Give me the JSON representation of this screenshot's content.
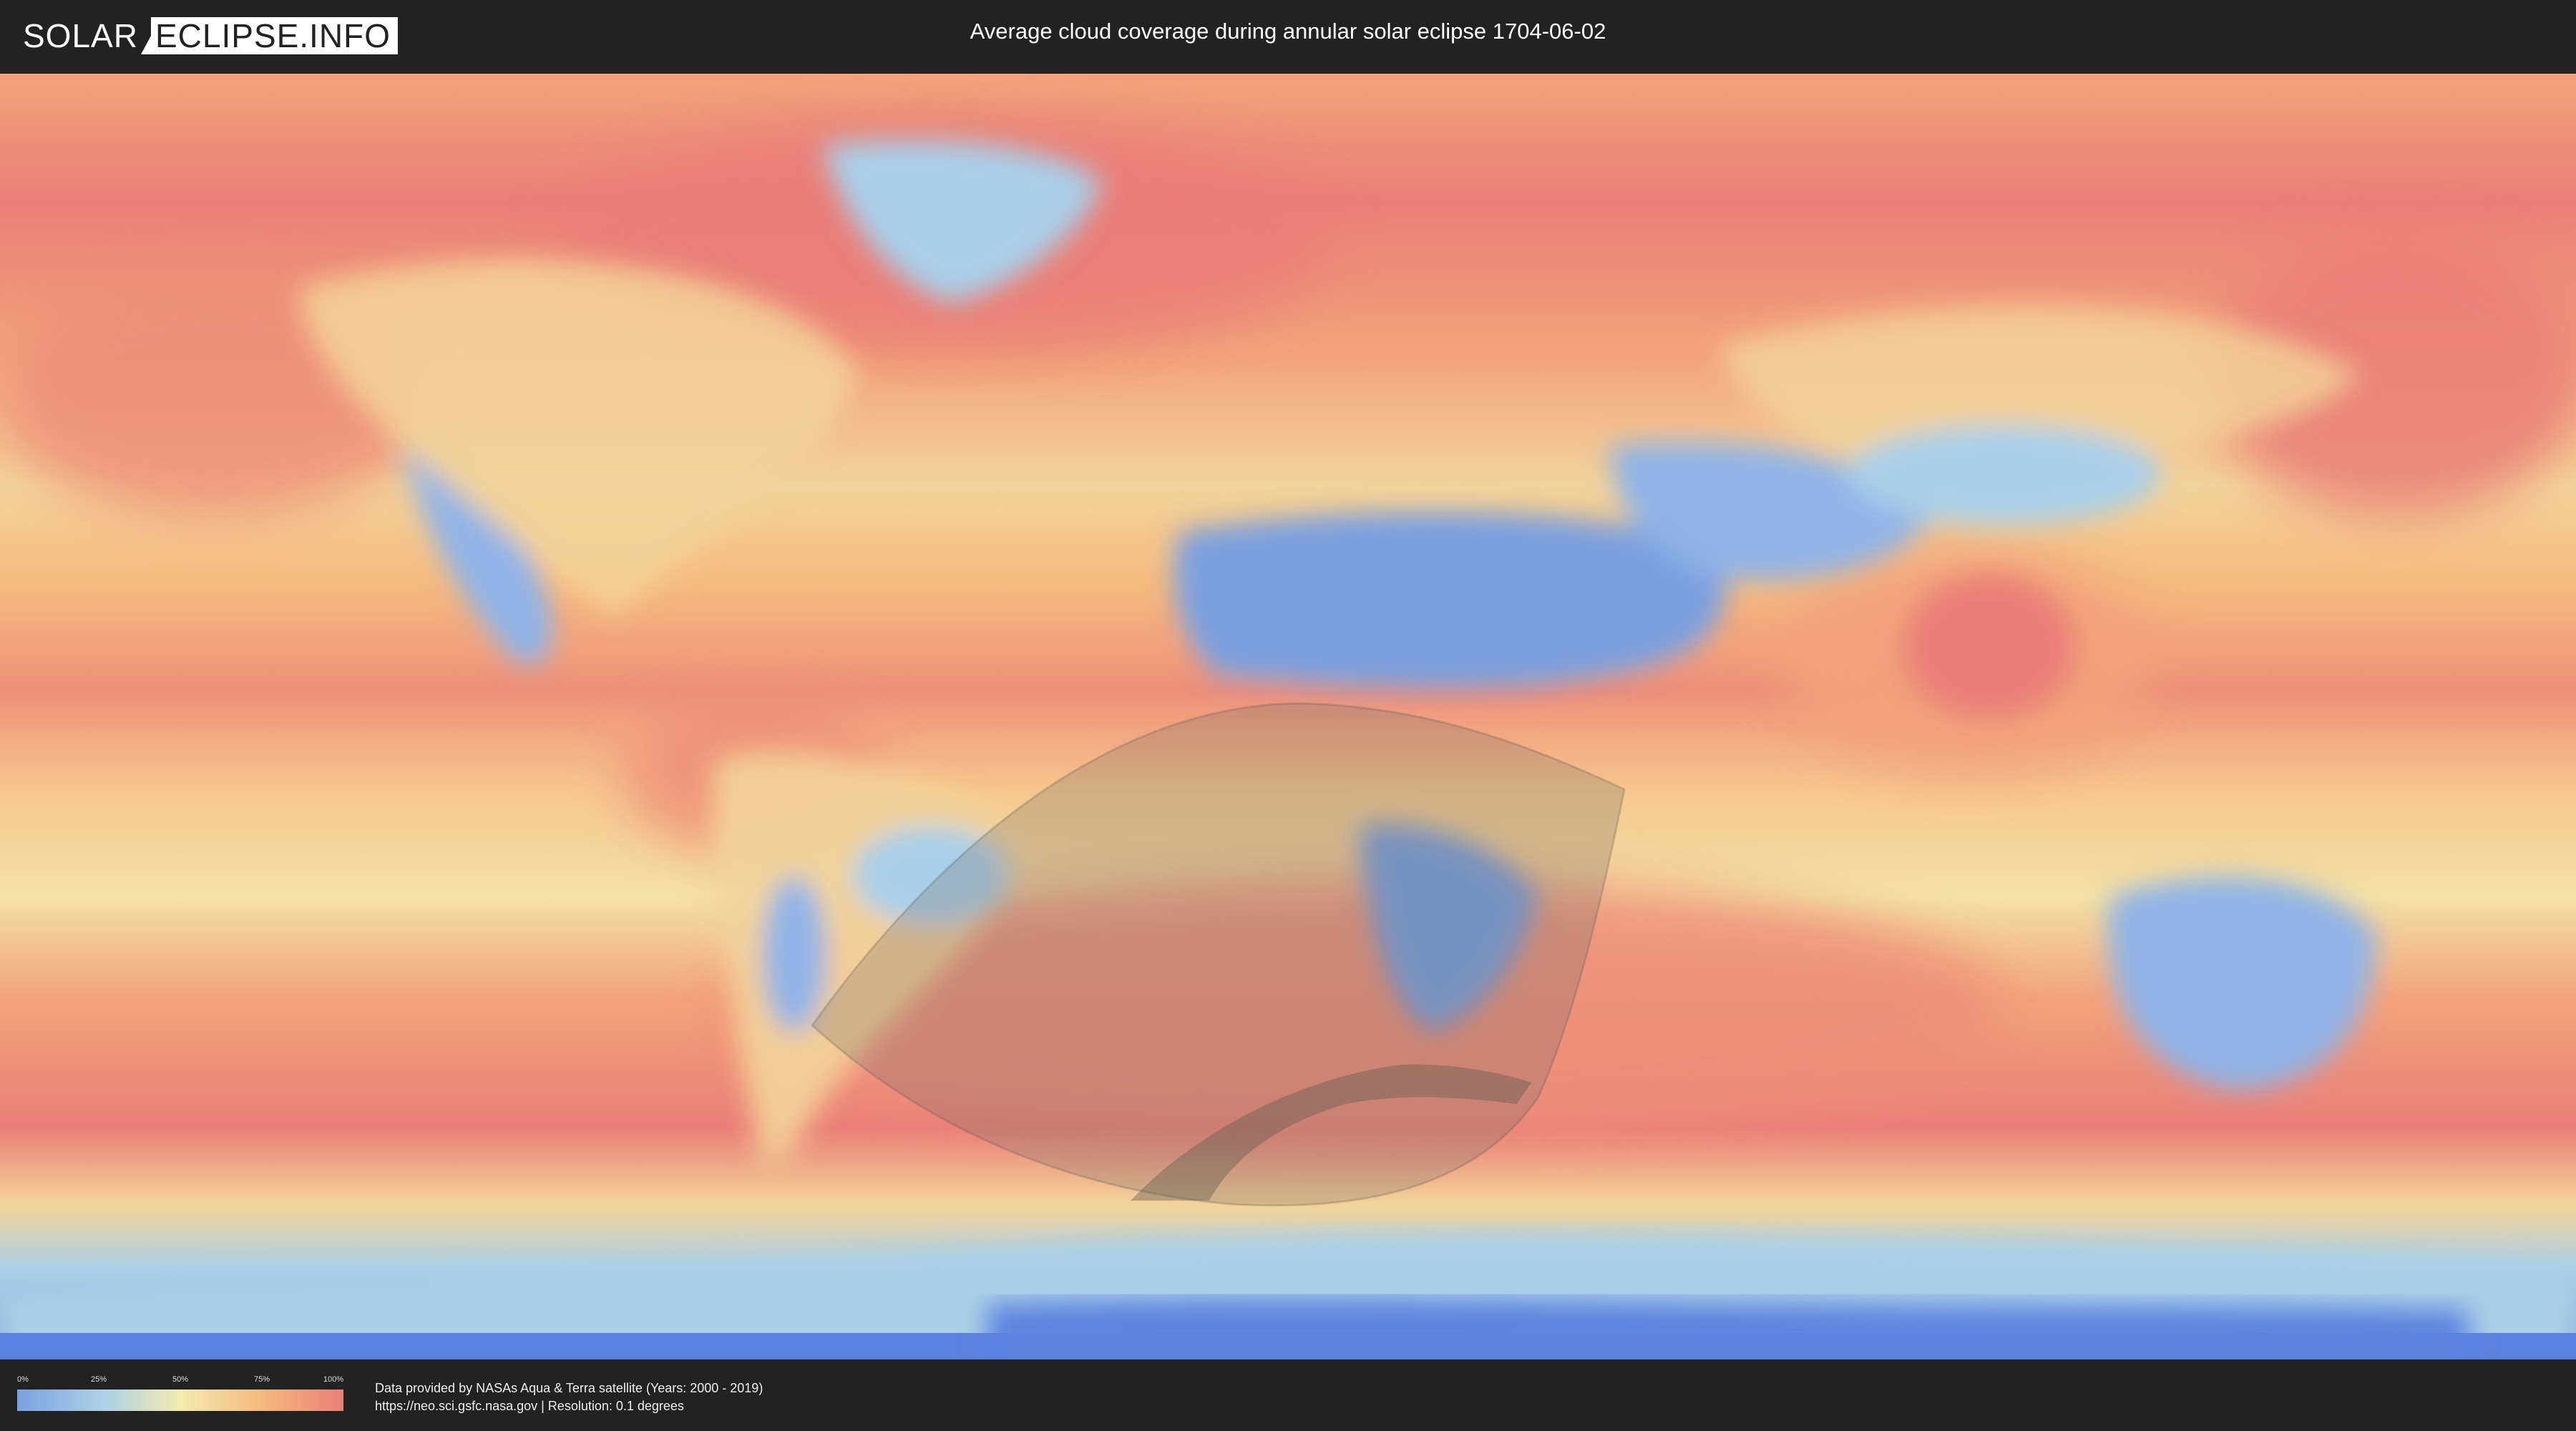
{
  "header": {
    "logo_solar": "SOLAR",
    "logo_box": "ECLIPSE.INFO",
    "title": "Average cloud coverage during annular solar eclipse 1704-06-02"
  },
  "map": {
    "colors": {
      "clear": "#7aa0e0",
      "partly": "#a9cfe8",
      "medium": "#f3ebb0",
      "cloudy": "#f5b97e",
      "overcast": "#ea7f78",
      "antarctic_ice": "#5b82de",
      "eclipse_shade": "#6f6a60"
    }
  },
  "legend": {
    "ticks": [
      "0%",
      "25%",
      "50%",
      "75%",
      "100%"
    ]
  },
  "credits": {
    "line1": "Data provided by NASAs Aqua & Terra satellite (Years: 2000 - 2019)",
    "line2": "https://neo.sci.gsfc.nasa.gov | Resolution: 0.1 degrees"
  }
}
